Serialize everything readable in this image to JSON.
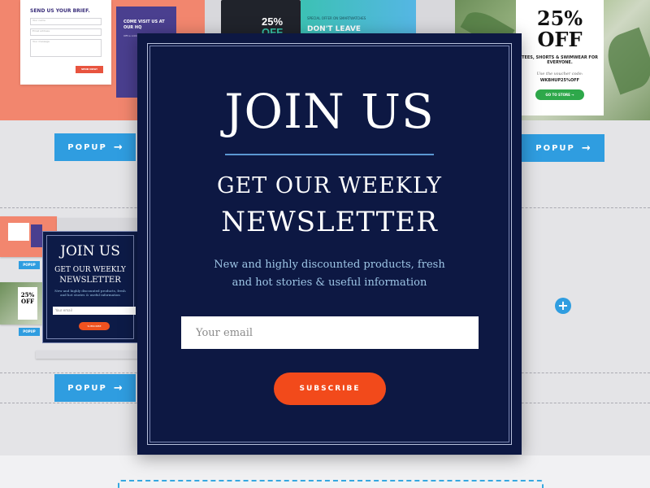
{
  "gallery": {
    "contact_card": {
      "title": "SEND US YOUR BRIEF.",
      "field1": "Your name",
      "field2": "Email address",
      "field3": "Your message",
      "button": "SEND NOW!"
    },
    "visit_card": {
      "title": "COME VISIT US AT OUR HQ",
      "details": "Office Address · email · phone"
    },
    "watch_promo": {
      "percent": "25%",
      "off": "OFF"
    },
    "teal_promo": {
      "subtitle": "SPECIAL OFFER ON SMARTWATCHES",
      "title": "DON'T LEAVE"
    },
    "discount_card": {
      "big": "25%",
      "off": "OFF",
      "subtitle": "TEES, SHORTS & SWIMWEAR FOR EVERYONE.",
      "note": "Use the voucher code:",
      "code": "WKBHUP25%OFF",
      "button": "GO TO STORE →"
    },
    "popup_buttons": [
      {
        "label": "POPUP",
        "arrow": "→"
      },
      {
        "label": "POPUP",
        "arrow": "→"
      },
      {
        "label": "POPUP",
        "arrow": "→"
      }
    ],
    "mini_popup_label": "POPUP",
    "mini_join": {
      "title": "JOIN US",
      "subtitle1": "GET OUR WEEKLY",
      "subtitle2": "NEWSLETTER",
      "desc": "New and highly discounted products, fresh and hot stories & useful information",
      "email_placeholder": "Your email",
      "button": "SUBSCRIBE"
    },
    "mini_discount": {
      "big": "25%",
      "off": "OFF"
    },
    "plus_symbol": "+"
  },
  "modal": {
    "title": "JOIN US",
    "subtitle_line1": "GET OUR WEEKLY",
    "subtitle_line2": "NEWSLETTER",
    "description_line1": "New and highly discounted products, fresh",
    "description_line2": "and hot stories & useful information",
    "email_placeholder": "Your email",
    "subscribe_label": "SUBSCRIBE"
  },
  "colors": {
    "modal_bg": "#0d1843",
    "accent_blue": "#2f9de0",
    "subscribe_orange": "#f24a1b",
    "salmon": "#f2866e"
  }
}
